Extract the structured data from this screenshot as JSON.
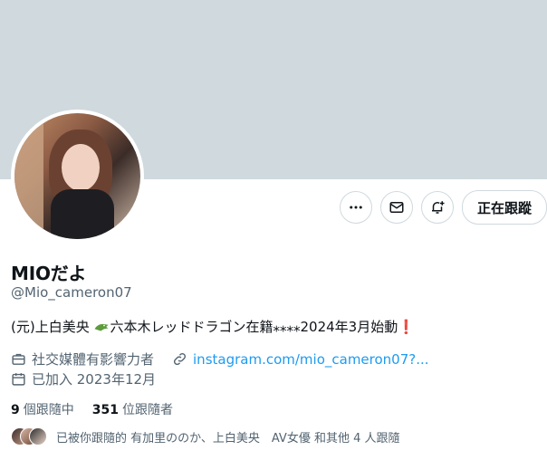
{
  "profile": {
    "name": "MIOだよ",
    "handle": "@Mio_cameron07",
    "bio_text": "(元)上白美央 ",
    "bio_text2": "六本木レッドドラゴン在籍⁎⁎⁎⁎2024年3月始動",
    "bio_excl": "❗",
    "category": "社交媒體有影響力者",
    "link": "instagram.com/mio_cameron07?...",
    "joined": "已加入 2023年12月"
  },
  "actions": {
    "more_icon": "more-icon",
    "message_icon": "envelope-icon",
    "notify_icon": "bell-plus-icon",
    "follow_label": "正在跟蹤"
  },
  "stats": {
    "following_count": "9",
    "following_label": "個跟隨中",
    "followers_count": "351",
    "followers_label": "位跟隨者"
  },
  "followed_by": {
    "text": "已被你跟隨的 有加里ののか、上白美央　AV女優 和其他 4 人跟隨"
  },
  "colors": {
    "banner": "#cfd9de",
    "link": "#1d9bf0",
    "secondary_text": "#536471"
  }
}
